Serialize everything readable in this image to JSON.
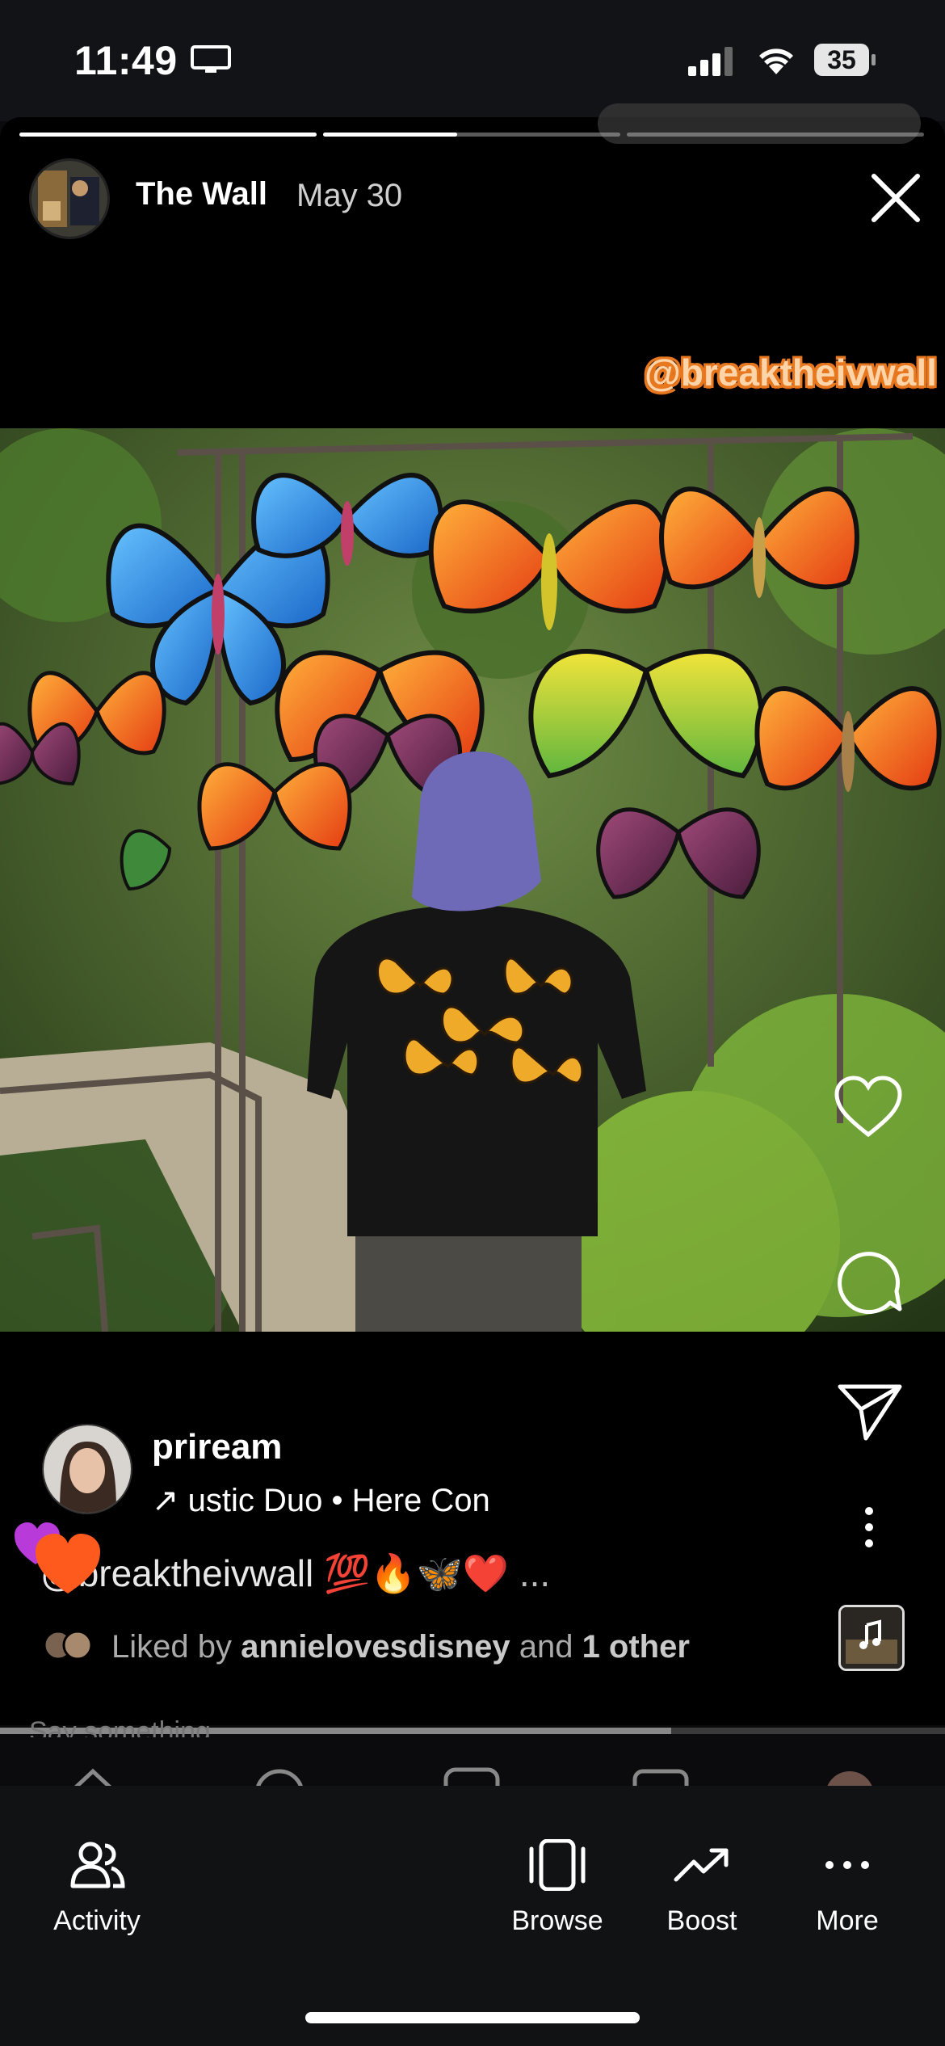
{
  "status_bar": {
    "time": "11:49",
    "battery": "35"
  },
  "story": {
    "username": "The Wall",
    "date": "May 30",
    "progress": [
      1.0,
      0.45,
      0.0
    ],
    "mention_sticker": "@breaktheivwall"
  },
  "post": {
    "username": "priream",
    "audio": "↗ ustic Duo • Here Con",
    "caption": "@breaktheivwall 💯🔥🦋❤️",
    "caption_more": "...",
    "liked_by_prefix": "Liked by ",
    "liked_by_user": "annielovesdisney",
    "liked_by_mid": " and ",
    "liked_by_count": "1 other",
    "comment_placeholder": "Say something...",
    "video_progress": 0.71
  },
  "toolbar": {
    "items": [
      {
        "label": "Activity",
        "icon": "people-icon"
      },
      {
        "label": "Browse",
        "icon": "phone-frame-icon"
      },
      {
        "label": "Boost",
        "icon": "trend-up-icon"
      },
      {
        "label": "More",
        "icon": "ellipsis-icon"
      }
    ]
  }
}
